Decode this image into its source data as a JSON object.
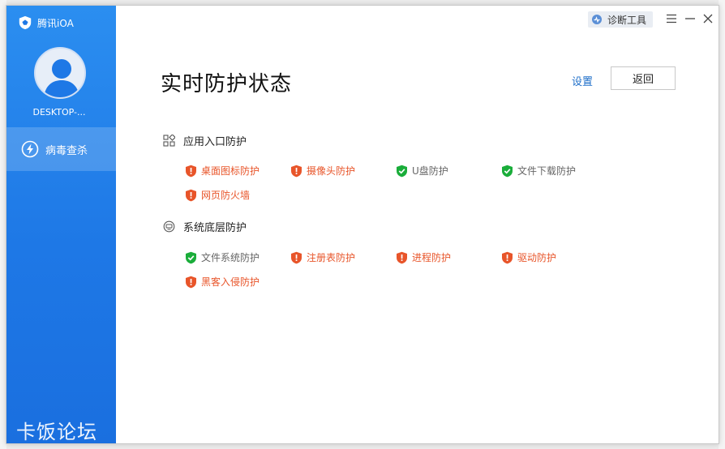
{
  "colors": {
    "warn": "#e8552a",
    "ok": "#1aad3a",
    "sidebar": "#1e78e6",
    "link": "#1f6fc9"
  },
  "window": {
    "brand": "腾讯iOA",
    "diag_tool_label": "诊断工具",
    "controls": [
      "menu-icon",
      "minimize-icon",
      "close-icon"
    ]
  },
  "sidebar": {
    "hostname": "DESKTOP-...",
    "nav": [
      {
        "label": "病毒查杀",
        "icon": "lightning-icon"
      }
    ],
    "watermark": "卡饭论坛"
  },
  "main": {
    "title": "实时防护状态",
    "settings_label": "设置",
    "back_label": "返回",
    "sections": [
      {
        "label": "应用入口防护",
        "icon": "apps-grid-icon",
        "items": [
          {
            "label": "桌面图标防护",
            "status": "warn"
          },
          {
            "label": "摄像头防护",
            "status": "warn"
          },
          {
            "label": "U盘防护",
            "status": "ok"
          },
          {
            "label": "文件下载防护",
            "status": "ok"
          },
          {
            "label": "网页防火墙",
            "status": "warn"
          }
        ]
      },
      {
        "label": "系统底层防护",
        "icon": "system-chip-icon",
        "items": [
          {
            "label": "文件系统防护",
            "status": "ok"
          },
          {
            "label": "注册表防护",
            "status": "warn"
          },
          {
            "label": "进程防护",
            "status": "warn"
          },
          {
            "label": "驱动防护",
            "status": "warn"
          },
          {
            "label": "黑客入侵防护",
            "status": "warn"
          }
        ]
      }
    ]
  }
}
